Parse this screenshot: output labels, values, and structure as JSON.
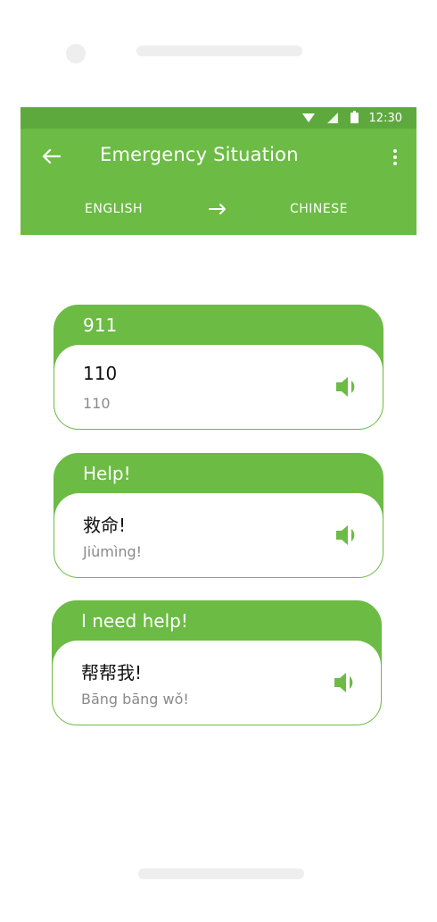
{
  "status_bar": {
    "time": "12:30"
  },
  "app_bar": {
    "title": "Emergency Situation",
    "source_language": "ENGLISH",
    "target_language": "CHINESE"
  },
  "phrases": [
    {
      "english": "911",
      "translation": "110",
      "pinyin": "110"
    },
    {
      "english": "Help!",
      "translation": "救命!",
      "pinyin": "Jiùmìng!"
    },
    {
      "english": "I need help!",
      "translation": "帮帮我!",
      "pinyin": "Bāng bāng wǒ!"
    }
  ],
  "colors": {
    "accent": "#6cbb45",
    "status_bar": "#5ea93e",
    "pinyin_text": "#8a8a8a"
  },
  "icons": {
    "back": "arrow-left-icon",
    "more": "more-vertical-icon",
    "direction": "arrow-right-icon",
    "speaker": "volume-icon"
  }
}
